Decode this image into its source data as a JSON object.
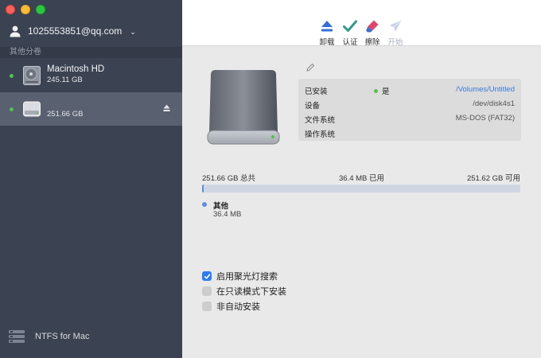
{
  "account": {
    "email": "1025553851@qq.com",
    "chevron": "⌄"
  },
  "sidebar": {
    "section_label": "其他分卷",
    "drives": [
      {
        "name": "Macintosh HD",
        "size": "245.11 GB",
        "icon": "internal-disk-icon"
      },
      {
        "name": "",
        "size": "251.66 GB",
        "icon": "external-disk-icon"
      }
    ],
    "footer_label": "NTFS for Mac"
  },
  "toolbar": {
    "unmount": "卸载",
    "verify": "认证",
    "erase": "擦除",
    "start": "开始"
  },
  "info": {
    "mounted_label": "已安装",
    "mounted_status": "是",
    "mounted_path": "/Volumes/Untitled",
    "device_label": "设备",
    "device_value": "/dev/disk4s1",
    "fs_label": "文件系统",
    "fs_value": "MS-DOS (FAT32)",
    "os_label": "操作系统",
    "os_value": ""
  },
  "usage": {
    "total": "251.66 GB 总共",
    "used": "36.4 MB 已用",
    "free": "251.62 GB 可用",
    "used_fraction": 0.0015,
    "legend_name": "其他",
    "legend_size": "36.4 MB"
  },
  "options": {
    "spotlight": {
      "label": "启用聚光灯搜索",
      "checked": true
    },
    "readonly": {
      "label": "在只读模式下安装",
      "checked": false
    },
    "no_auto": {
      "label": "非自动安装",
      "checked": false
    }
  },
  "colors": {
    "sidebar_bg": "#3b4251",
    "selected_bg": "#596070",
    "accent": "#2b7cf5",
    "status_green": "#52c24a",
    "link": "#3a7bd5"
  }
}
